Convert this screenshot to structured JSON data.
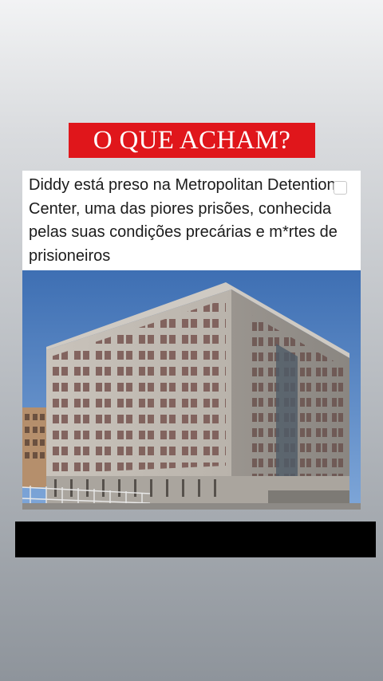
{
  "banner": {
    "title": "O QUE ACHAM?"
  },
  "post": {
    "text": "Diddy está preso na Metropolitan Detention Center, uma das piores prisões, conhecida pelas suas condições precárias e m*rtes de prisioneiros",
    "image_icon": "checkbox-icon",
    "photo_subject": "building-photo"
  },
  "colors": {
    "banner_bg": "#e0161b",
    "banner_text": "#ffffff",
    "card_bg": "#ffffff",
    "bar": "#000000"
  }
}
